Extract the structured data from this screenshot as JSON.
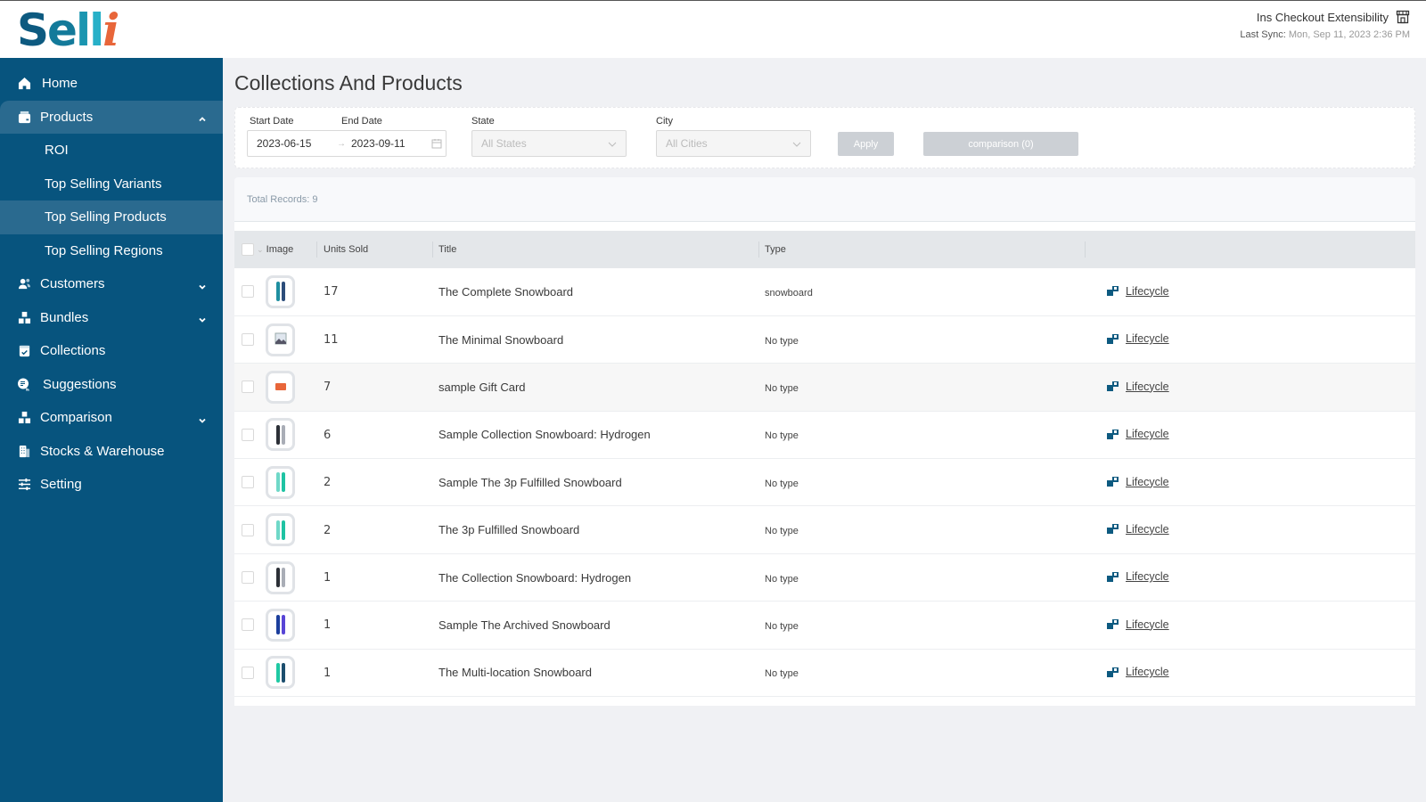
{
  "header": {
    "logo_text": [
      "S",
      "e",
      "l",
      "l",
      "i"
    ],
    "store_name": "Ins Checkout Extensibility",
    "store_icon": "storefront-icon",
    "last_sync_label": "Last Sync:",
    "last_sync_value": " Mon, Sep 11, 2023 2:36 PM"
  },
  "sidebar": {
    "items": [
      {
        "label": "Home",
        "icon": "home-icon"
      },
      {
        "label": "Products",
        "icon": "package-icon",
        "expanded": true,
        "children": [
          {
            "label": "ROI"
          },
          {
            "label": "Top Selling Variants"
          },
          {
            "label": "Top Selling Products",
            "active": true
          },
          {
            "label": "Top Selling Regions"
          }
        ]
      },
      {
        "label": "Customers",
        "icon": "users-icon",
        "chevron": "down"
      },
      {
        "label": "Bundles",
        "icon": "boxes-icon",
        "chevron": "down"
      },
      {
        "label": "Collections",
        "icon": "calendar-check-icon"
      },
      {
        "label": "Suggestions",
        "icon": "chat-bubble-icon"
      },
      {
        "label": "Comparison",
        "icon": "boxes-icon",
        "chevron": "down"
      },
      {
        "label": "Stocks & Warehouse",
        "icon": "building-icon"
      },
      {
        "label": "Setting",
        "icon": "sliders-icon"
      }
    ]
  },
  "main": {
    "title": "Collections And Products",
    "filters": {
      "start_date_label": "Start Date",
      "end_date_label": "End Date",
      "start_date": "2023-06-15",
      "end_date": "2023-09-11",
      "range_separator": "→",
      "state_label": "State",
      "state_placeholder": "All States",
      "city_label": "City",
      "city_placeholder": "All Cities",
      "apply_label": "Apply",
      "comparison_label": "comparison (0)"
    },
    "total_records": "Total Records: 9",
    "table": {
      "columns": [
        "Image",
        "Units Sold",
        "Title",
        "Type",
        ""
      ],
      "rows": [
        {
          "units": "17",
          "title": "The Complete Snowboard",
          "type": "snowboard",
          "action": "Lifecycle",
          "colors": [
            "#1f8fa0",
            "#2c4d7a"
          ]
        },
        {
          "units": "11",
          "title": "The Minimal Snowboard",
          "type": "No type",
          "action": "Lifecycle",
          "colors": [
            "broken"
          ]
        },
        {
          "units": "7",
          "title": "sample Gift Card",
          "type": "No type",
          "action": "Lifecycle",
          "colors": [
            "giftcard"
          ]
        },
        {
          "units": "6",
          "title": "Sample Collection Snowboard: Hydrogen",
          "type": "No type",
          "action": "Lifecycle",
          "colors": [
            "#2b2f36",
            "#a9adb6"
          ]
        },
        {
          "units": "2",
          "title": "Sample The 3p Fulfilled Snowboard",
          "type": "No type",
          "action": "Lifecycle",
          "colors": [
            "#6fd8c8",
            "#1fc3a3"
          ]
        },
        {
          "units": "2",
          "title": "The 3p Fulfilled Snowboard",
          "type": "No type",
          "action": "Lifecycle",
          "colors": [
            "#6fd8c8",
            "#1fc3a3"
          ]
        },
        {
          "units": "1",
          "title": "The Collection Snowboard: Hydrogen",
          "type": "No type",
          "action": "Lifecycle",
          "colors": [
            "#2b2f36",
            "#a9adb6"
          ]
        },
        {
          "units": "1",
          "title": "Sample The Archived Snowboard",
          "type": "No type",
          "action": "Lifecycle",
          "colors": [
            "#1b3e9c",
            "#5845d6"
          ]
        },
        {
          "units": "1",
          "title": "The Multi-location Snowboard",
          "type": "No type",
          "action": "Lifecycle",
          "colors": [
            "#1fc9a3",
            "#1c4e6e"
          ]
        }
      ]
    }
  },
  "colors": {
    "sidebar_bg": "#07547e",
    "sidebar_active": "#2a6a8f",
    "accent": "#0d5a80",
    "logo_orange": "#e8663a"
  }
}
